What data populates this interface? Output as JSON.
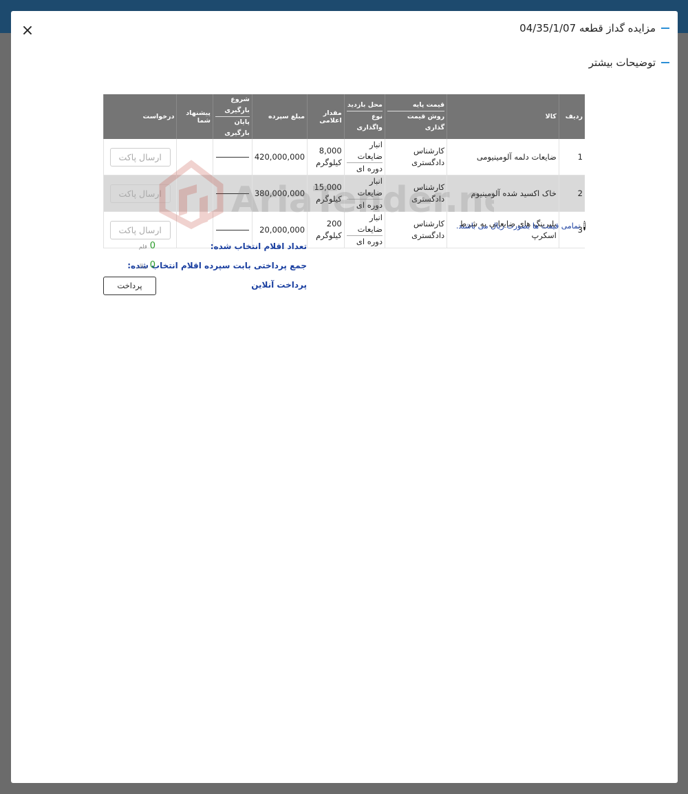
{
  "modal": {
    "title": "مزایده گداز قطعه 04/35/1/07",
    "section_title": "توضیحات بیشتر",
    "close_symbol": "×"
  },
  "table": {
    "headers": {
      "row": "ردیف",
      "item": "کالا",
      "base_price": "قیمت پایه",
      "pricing_method": "روش قیمت گذاری",
      "visit_place": "محل بازدید",
      "assignment_type": "نوع واگذاری",
      "declared_amount": "مقدار اعلامی",
      "deposit": "مبلغ سپرده",
      "loading_start": "شروع بارگیری",
      "loading_end": "پایان بارگیری",
      "your_offer": "پیشنهاد شما",
      "request": "درخواست"
    },
    "rows": [
      {
        "row": "1",
        "item": "ضایعات دلمه آلومینیومی",
        "pricing_method": "کارشناس دادگستری",
        "visit_place": "انبار ضایعات",
        "assignment_type": "دوره ای",
        "amount": "8,000",
        "unit": "کیلوگرم",
        "deposit": "420,000,000",
        "request_button": "ارسال پاکت"
      },
      {
        "row": "2",
        "item": "خاک اکسید شده آلومینیوم",
        "pricing_method": "کارشناس دادگستری",
        "visit_place": "انبار ضایعات",
        "assignment_type": "دوره ای",
        "amount": "15,000",
        "unit": "کیلوگرم",
        "deposit": "380,000,000",
        "request_button": "ارسال پاکت"
      },
      {
        "row": "3",
        "item": "بلبرینگ های ضایعاتی به شرط اسکرپ",
        "pricing_method": "کارشناس دادگستری",
        "visit_place": "انبار ضایعات",
        "assignment_type": "دوره ای",
        "amount": "200",
        "unit": "کیلوگرم",
        "deposit": "20,000,000",
        "request_button": "ارسال پاکت"
      }
    ]
  },
  "note": {
    "icon": "info-icon",
    "text": "تمامی قیمت ها بصورت ریال می باشند."
  },
  "summary": {
    "selected_count_label": "تعداد اقلام انتخاب شده:",
    "selected_count_value": "0",
    "selected_count_unit": "قلم",
    "total_label": "جمع پرداختی بابت سپرده اقلام انتخاب شده:",
    "total_value": "0",
    "total_unit": "ریال",
    "online_payment_label": "پرداخت آنلاین",
    "pay_button": "پرداخت"
  },
  "watermark": {
    "text": "AriaTender.net"
  },
  "colors": {
    "topbar": "#1d4a6e",
    "accent": "#2b8fd6",
    "table_header": "#757575",
    "link_blue": "#1a3fa0",
    "green_value": "#2a9a2a"
  }
}
